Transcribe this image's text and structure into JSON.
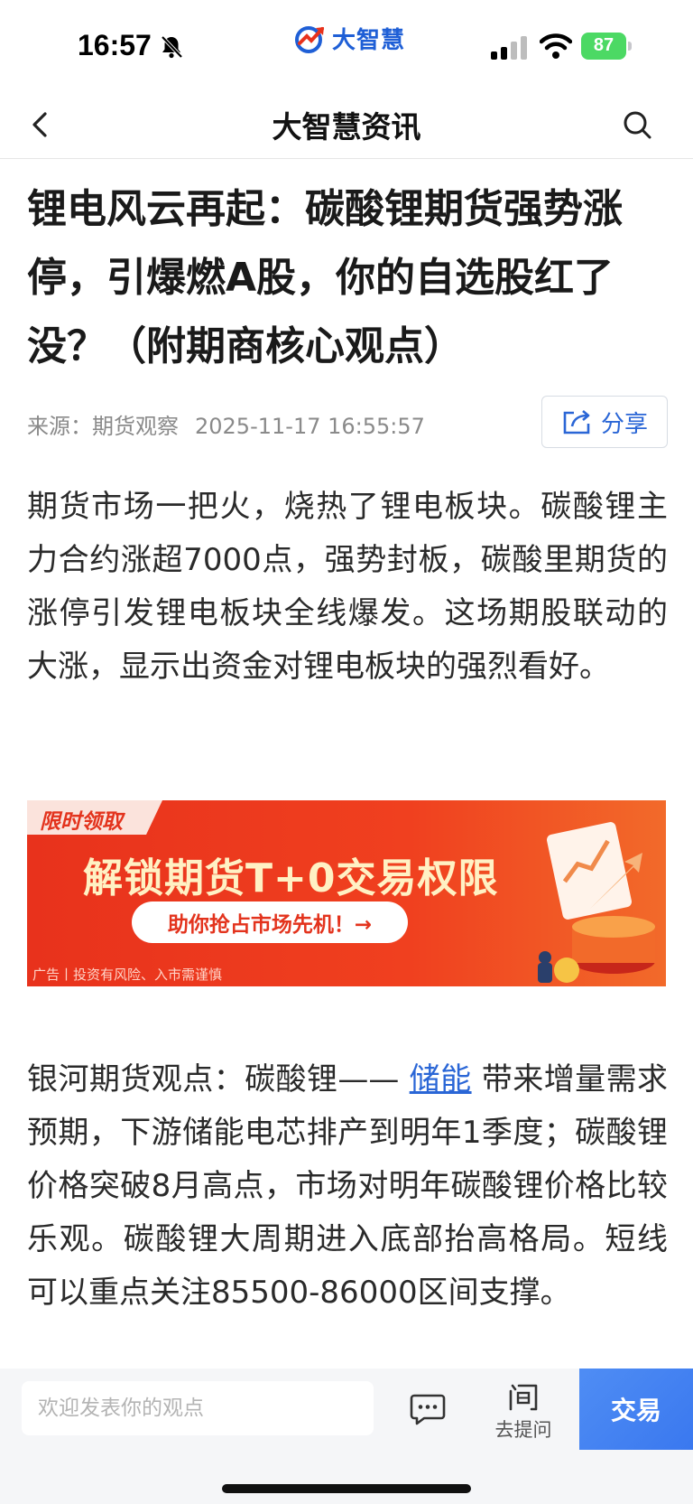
{
  "status_bar": {
    "time": "16:57",
    "brand": "大智慧",
    "battery": "87"
  },
  "nav": {
    "title": "大智慧资讯"
  },
  "article": {
    "title": "锂电风云再起：碳酸锂期货强势涨停，引爆燃A股，你的自选股红了没？（附期商核心观点）",
    "source": "来源：期货观察",
    "date": "2025-11-17 16:55:57",
    "share_label": "分享",
    "para1": "期货市场一把火，烧热了锂电板块。碳酸锂主力合约涨超7000点，强势封板，碳酸里期货的涨停引发锂电板块全线爆发。这场期股联动的大涨，显示出资金对锂电板块的强烈看好。",
    "para2_prefix": "银河期货观点：碳酸锂——",
    "para2_link": "储能",
    "para2_suffix": "带来增量需求预期，下游储能电芯排产到明年1季度；碳酸锂价格突破8月高点，市场对明年碳酸锂价格比较乐观。碳酸锂大周期进入底部抬高格局。短线可以重点关注85500-86000区间支撑。"
  },
  "ad": {
    "tag": "限时领取",
    "headline": "解锁期货T+0交易权限",
    "cta": "助你抢占市场先机！→",
    "disclaimer": "广告丨投资有风险、入市需谨慎"
  },
  "bottom_bar": {
    "comment_placeholder": "欢迎发表你的观点",
    "ask_label": "去提问",
    "trade_label": "交易"
  },
  "colors": {
    "link": "#2a66d6",
    "trade": "#3a78ef",
    "ad_bg": "#e8321c",
    "battery": "#4cd964"
  }
}
